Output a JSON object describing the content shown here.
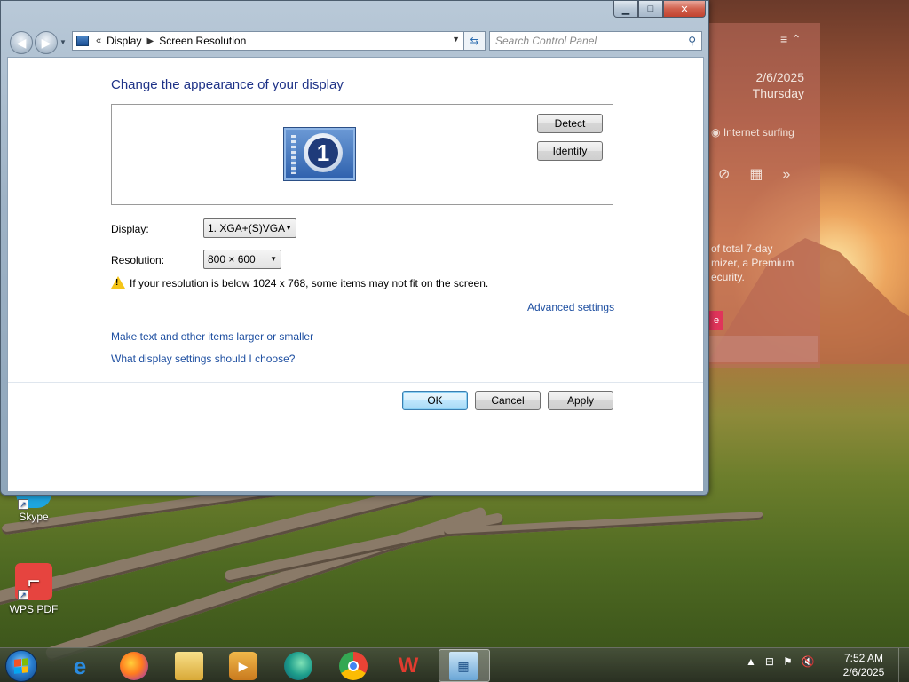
{
  "window": {
    "caption_min": "▁",
    "caption_max": "□",
    "caption_close": "✕"
  },
  "navigation": {
    "back": "◀",
    "forward": "▶",
    "breadcrumb_prefix": "«",
    "breadcrumb": [
      "Display",
      "Screen Resolution"
    ],
    "search_placeholder": "Search Control Panel"
  },
  "content": {
    "heading": "Change the appearance of your display",
    "monitor_number": "1",
    "detect_button": "Detect",
    "identify_button": "Identify",
    "display_label": "Display:",
    "display_value": "1. XGA+(S)VGA",
    "resolution_label": "Resolution:",
    "resolution_value": "800 × 600",
    "warning_text": "If your resolution is below 1024 x 768, some items may not fit on the screen.",
    "advanced_settings_link": "Advanced settings",
    "links": [
      "Make text and other items larger or smaller",
      "What display settings should I choose?"
    ],
    "ok_button": "OK",
    "cancel_button": "Cancel",
    "apply_button": "Apply"
  },
  "desktop_icons": [
    {
      "label": "Skype",
      "icon": "skype-icon"
    },
    {
      "label": "WPS PDF",
      "icon": "wps-pdf-icon"
    }
  ],
  "gadget": {
    "date": "2/6/2025",
    "day": "Thursday",
    "status": "Internet surfing",
    "text": "of total 7-day\nmizer, a Premium\necurity."
  },
  "taskbar": {
    "apps": [
      "internet-explorer-icon",
      "firefox-icon",
      "file-explorer-icon",
      "media-player-icon",
      "edge-icon",
      "chrome-icon",
      "wps-office-icon",
      "display-settings-icon"
    ],
    "time": "7:52 AM",
    "date": "2/6/2025"
  },
  "colors": {
    "heading": "#1e3287",
    "link": "#1e4fa1",
    "warning": "#f5c518"
  }
}
